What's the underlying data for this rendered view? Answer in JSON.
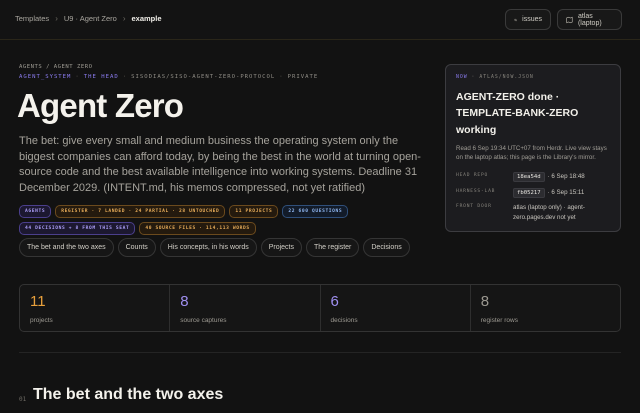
{
  "breadcrumb": [
    "Templates",
    "U9 · Agent Zero",
    "example"
  ],
  "topbar": {
    "issues_label": "issues",
    "atlas_label": "atlas (laptop)"
  },
  "hero": {
    "kicker": "AGENTS / AGENT ZERO",
    "meta": {
      "a": "AGENT_SYSTEM",
      "b": "THE HEAD",
      "c": "SISODIAS/SISO-AGENT-ZERO-PROTOCOL",
      "d": "PRIVATE"
    },
    "title": "Agent Zero",
    "lede": "The bet: give every small and medium business the operating system only the biggest companies can afford today, by being the best in the world at turning open-source code and the best available intelligence into working systems. Deadline 31 December 2029. (INTENT.md, his memos compressed, not yet ratified)"
  },
  "pills": [
    {
      "text": "AGENTS",
      "tone": "purple"
    },
    {
      "text": "REGISTER · 7 LANDED · 24 PARTIAL · 28 UNTOUCHED",
      "tone": "orange"
    },
    {
      "text": "11 PROJECTS",
      "tone": "orange"
    },
    {
      "text": "22 600 QUESTIONS",
      "tone": "blue"
    },
    {
      "text": "44 DECISIONS + 8 FROM THIS SEAT",
      "tone": "purple"
    },
    {
      "text": "40 SOURCE FILES · 114,113 WORDS",
      "tone": "orange"
    }
  ],
  "tabs": [
    "The bet and the two axes",
    "Counts",
    "His concepts, in his words",
    "Projects",
    "The register",
    "Decisions"
  ],
  "card": {
    "label_a": "NOW",
    "label_b": "ATLAS/NOW.JSON",
    "headline": "AGENT-ZERO done · TEMPLATE-BANK-ZERO working",
    "desc": "Read 6 Sep 19:34 UTC+07 from Herdr. Live view stays on the laptop atlas; this page is the Library's mirror.",
    "rows": [
      {
        "key": "HEAD REPO",
        "code": "18ea54d",
        "text": "· 6 Sep 18:48"
      },
      {
        "key": "HARNESS-LAB",
        "code": "fb05217",
        "text": "· 6 Sep 15:11"
      },
      {
        "key": "FRONT DOOR",
        "code": "",
        "text": "atlas (laptop only) · agent-zero.pages.dev not yet"
      }
    ]
  },
  "stats": [
    {
      "value": "11",
      "caption": "projects",
      "color": "#e8a03c"
    },
    {
      "value": "8",
      "caption": "source captures",
      "color": "#9f8ff0"
    },
    {
      "value": "6",
      "caption": "decisions",
      "color": "#9f8ff0"
    },
    {
      "value": "8",
      "caption": "register rows",
      "color": "#9b9890"
    }
  ],
  "section": {
    "number": "01",
    "title": "The bet and the two axes"
  }
}
